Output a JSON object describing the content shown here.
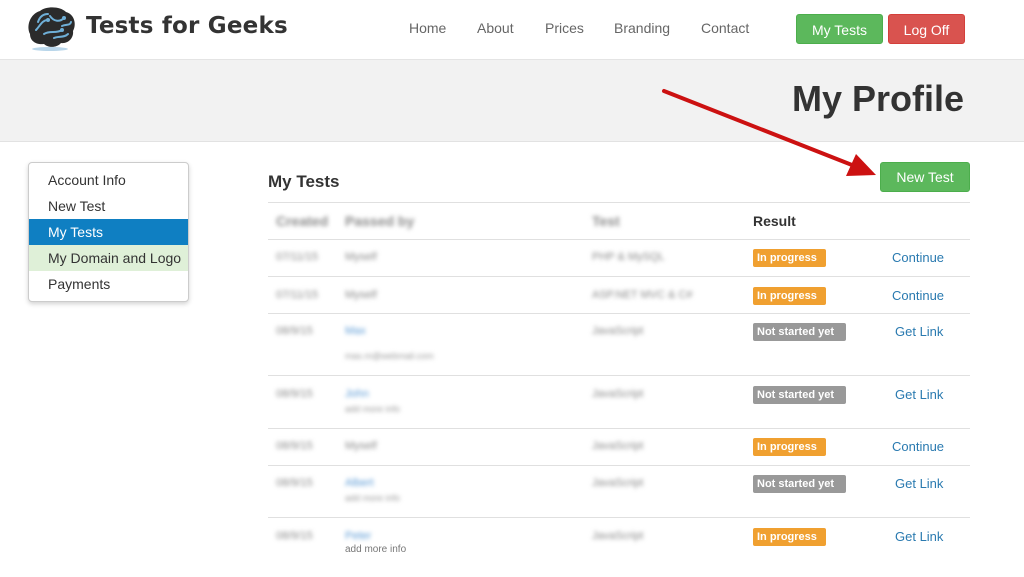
{
  "header": {
    "brand": "Tests for Geeks",
    "nav": [
      "Home",
      "About",
      "Prices",
      "Branding",
      "Contact"
    ],
    "my_tests_button": "My Tests",
    "log_off_button": "Log Off"
  },
  "banner": {
    "title": "My Profile"
  },
  "sidebar": {
    "items": [
      {
        "label": "Account Info",
        "state": "normal"
      },
      {
        "label": "New Test",
        "state": "normal"
      },
      {
        "label": "My Tests",
        "state": "active"
      },
      {
        "label": "My Domain and Logo",
        "state": "hover"
      },
      {
        "label": "Payments",
        "state": "normal"
      }
    ]
  },
  "main": {
    "title": "My Tests",
    "new_test_button": "New Test",
    "columns": [
      "Created",
      "Passed by",
      "Test",
      "Result"
    ],
    "rows": [
      {
        "created": "07/11/15",
        "passed_by": "Myself",
        "passed_by_sub": "",
        "test": "PHP & MySQL",
        "result": "In progress",
        "action": "Continue"
      },
      {
        "created": "07/11/15",
        "passed_by": "Myself",
        "passed_by_sub": "",
        "test": "ASP.NET MVC & C#",
        "result": "In progress",
        "action": "Continue"
      },
      {
        "created": "08/9/15",
        "passed_by": "Max",
        "passed_by_sub": "max.m@webmail.com",
        "test": "JavaScript",
        "result": "Not started yet",
        "action": "Get Link"
      },
      {
        "created": "08/9/15",
        "passed_by": "John",
        "passed_by_sub": "add more info",
        "test": "JavaScript",
        "result": "Not started yet",
        "action": "Get Link"
      },
      {
        "created": "08/9/15",
        "passed_by": "Myself",
        "passed_by_sub": "",
        "test": "JavaScript",
        "result": "In progress",
        "action": "Continue"
      },
      {
        "created": "08/9/15",
        "passed_by": "Albert",
        "passed_by_sub": "add more info",
        "test": "JavaScript",
        "result": "Not started yet",
        "action": "Get Link"
      },
      {
        "created": "08/9/15",
        "passed_by": "Peter",
        "passed_by_sub": "add more info",
        "test": "JavaScript",
        "result": "In progress",
        "action": "Get Link"
      }
    ]
  },
  "colors": {
    "primary_green": "#5cb85c",
    "danger_red": "#d9534f",
    "active_blue": "#0f7fc2",
    "in_progress": "#f0a030",
    "not_started": "#999999",
    "arrow": "#cc1111"
  }
}
